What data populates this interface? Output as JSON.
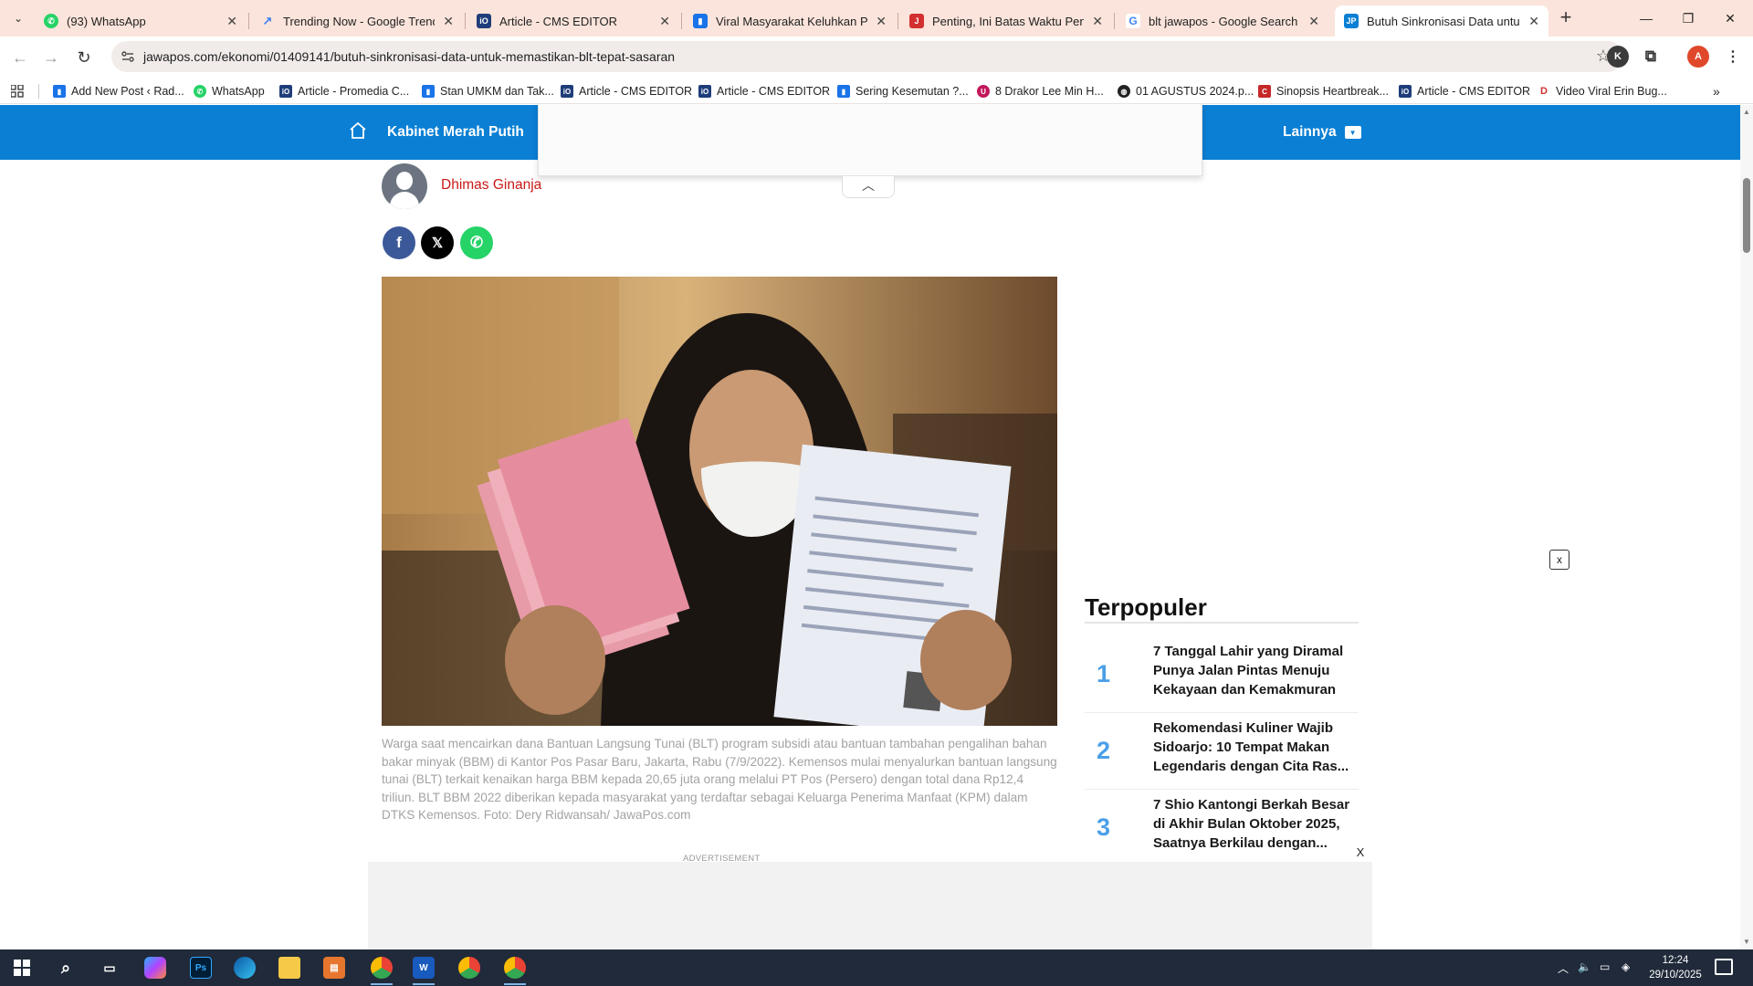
{
  "browser": {
    "tabs": [
      {
        "title": "(93) WhatsApp",
        "icon": "whatsapp-icon",
        "icon_color": "#25D366"
      },
      {
        "title": "Trending Now - Google Trends",
        "icon": "trends-icon",
        "icon_color": "#4285F4"
      },
      {
        "title": "Article - CMS EDITOR",
        "icon": "cms-icon",
        "icon_color": "#1f3d7a"
      },
      {
        "title": "Viral Masyarakat Keluhkan Pert",
        "icon": "article-icon",
        "icon_color": "#1a73e8"
      },
      {
        "title": "Penting, Ini Batas Waktu Penca",
        "icon": "jawapos-j-icon",
        "icon_color": "#d32f2f"
      },
      {
        "title": "blt jawapos - Google Search",
        "icon": "google-icon",
        "icon_color": "#4285F4"
      },
      {
        "title": "Butuh Sinkronisasi Data untuk",
        "icon": "jawapos-jp-icon",
        "icon_color": "#0a7fd4",
        "active": true
      }
    ],
    "url": "jawapos.com/ekonomi/01409141/butuh-sinkronisasi-data-untuk-memastikan-blt-tepat-sasaran",
    "profile_initial": "A",
    "extension_initial": "K",
    "bookmarks": [
      {
        "label": "Add New Post ‹ Rad...",
        "icon_color": "#1a73e8"
      },
      {
        "label": "WhatsApp",
        "icon_color": "#25D366"
      },
      {
        "label": "Article - Promedia C...",
        "icon_color": "#1f3d7a"
      },
      {
        "label": "Stan UMKM dan Tak...",
        "icon_color": "#1a73e8"
      },
      {
        "label": "Article - CMS EDITOR",
        "icon_color": "#1f3d7a"
      },
      {
        "label": "Article - CMS EDITOR",
        "icon_color": "#1f3d7a"
      },
      {
        "label": "Sering Kesemutan ?...",
        "icon_color": "#1a73e8"
      },
      {
        "label": "8 Drakor Lee Min H...",
        "icon_color": "#c2185b"
      },
      {
        "label": "01 AGUSTUS 2024.p...",
        "icon_color": "#222222"
      },
      {
        "label": "Sinopsis Heartbreak...",
        "icon_color": "#c62828"
      },
      {
        "label": "Article - CMS EDITOR",
        "icon_color": "#1f3d7a"
      },
      {
        "label": "Video Viral Erin Bug...",
        "icon_color": "#d32f2f"
      }
    ]
  },
  "site": {
    "nav_label": "Kabinet Merah Putih",
    "more_label": "Lainnya",
    "brand_color": "#0a7fd4",
    "author": "Dhimas Ginanja",
    "photo_caption": "Warga saat mencairkan dana Bantuan Langsung Tunai (BLT) program subsidi atau bantuan tambahan pengalihan bahan bakar minyak (BBM) di Kantor Pos Pasar Baru, Jakarta, Rabu (7/9/2022). Kemensos mulai menyalurkan bantuan langsung tunai (BLT) terkait kenaikan harga BBM kepada 20,65 juta orang melalui PT Pos (Persero) dengan total dana Rp12,4 triliun. BLT BBM 2022 diberikan kepada masyarakat yang terdaftar sebagai Keluarga Penerima Manfaat (KPM) dalam DTKS Kemensos. Foto: Dery Ridwansah/ JawaPos.com",
    "ad_label": "ADVERTISEMENT",
    "close_x": "x",
    "close_X": "X",
    "popular": {
      "title": "Terpopuler",
      "items": [
        {
          "rank": "1",
          "title": "7 Tanggal Lahir yang Diramal Punya Jalan Pintas Menuju Kekayaan dan Kemakmuran"
        },
        {
          "rank": "2",
          "title": "Rekomendasi Kuliner Wajib Sidoarjo: 10 Tempat Makan Legendaris dengan Cita Ras..."
        },
        {
          "rank": "3",
          "title": "7 Shio Kantongi Berkah Besar di Akhir Bulan Oktober 2025, Saatnya Berkilau dengan..."
        }
      ]
    }
  },
  "taskbar": {
    "time": "12:24",
    "date": "29/10/2025",
    "apps": [
      "start-icon",
      "search-icon",
      "task-view-icon",
      "copilot-icon",
      "photoshop-icon",
      "edge-icon",
      "file-explorer-icon",
      "notes-app-icon",
      "chrome-profile-icon",
      "word-icon",
      "chrome-icon",
      "chrome-alt-icon"
    ]
  }
}
